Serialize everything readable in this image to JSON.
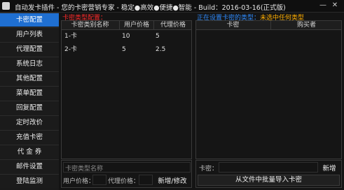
{
  "window": {
    "title": "自动发卡插件 - 您的卡密营销专家 - 稳定●高效●便捷●智能 - Build：2016-03-16(正式版)",
    "minimize_glyph": "—",
    "close_glyph": "✕"
  },
  "sidebar": {
    "items": [
      {
        "label": "卡密配置",
        "active": true
      },
      {
        "label": "用户列表"
      },
      {
        "label": "代理配置"
      },
      {
        "label": "系统日志"
      },
      {
        "label": "其他配置"
      },
      {
        "label": "菜单配置"
      },
      {
        "label": "回复配置"
      },
      {
        "label": "定时改价"
      },
      {
        "label": "充值卡密"
      },
      {
        "label": "代 金 券"
      },
      {
        "label": "邮件设置"
      },
      {
        "label": "登陆监测"
      }
    ]
  },
  "left_panel": {
    "title": "卡密类型配置：",
    "columns": [
      "卡密类别名称",
      "用户价格",
      "代理价格"
    ],
    "rows": [
      {
        "name": "1-卡",
        "user_price": "10",
        "agent_price": "5"
      },
      {
        "name": "2-卡",
        "user_price": "5",
        "agent_price": "2.5"
      }
    ]
  },
  "right_panel": {
    "title_prefix": "正在设置卡密的类型：",
    "title_status": "未选中任何类型",
    "columns": [
      "卡密",
      "购买者"
    ]
  },
  "type_form": {
    "name_placeholder": "卡密类型名称",
    "user_price_label": "用户价格：",
    "agent_price_label": "代理价格：",
    "add_edit_button": "新增/修改"
  },
  "card_form": {
    "card_label": "卡密：",
    "add_button": "新增",
    "import_button": "从文件中批量导入卡密"
  },
  "colors": {
    "accent": "#1f6fd1",
    "title_red": "#ff2a2a",
    "status_orange": "#ffae00",
    "panel_border": "#3a3a3a"
  }
}
